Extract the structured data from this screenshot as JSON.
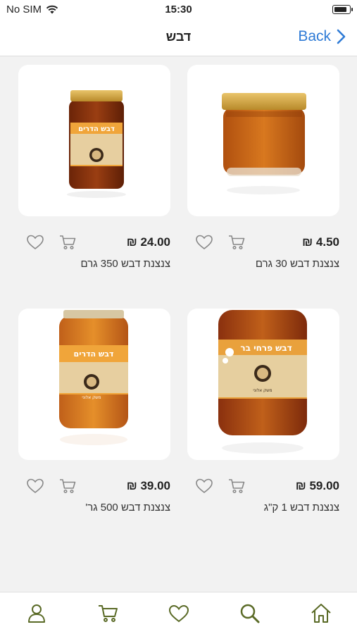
{
  "status": {
    "carrier": "No SIM",
    "time": "15:30"
  },
  "nav": {
    "title": "דבש",
    "back_label": "Back"
  },
  "products": [
    {
      "name": "צנצנת דבש 30 גרם",
      "price": "₪ 4.50"
    },
    {
      "name": "צנצנת דבש 350 גרם",
      "price": "₪ 24.00"
    },
    {
      "name": "צנצנת דבש 1 ק\"ג",
      "price": "₪ 59.00"
    },
    {
      "name": "צנצנת דבש 500 גר'",
      "price": "₪ 39.00"
    }
  ],
  "labels": {
    "jar_hadarim": "דבש הדרים",
    "jar_wildflowers": "דבש פרחי בר",
    "jar_brand": "משק אלוני"
  },
  "tabs": [
    "user-icon",
    "cart-icon",
    "heart-icon",
    "search-icon",
    "home-icon"
  ],
  "colors": {
    "accent": "#2f7bd6",
    "tab_icon": "#5a6a26",
    "honey": "#c0601a"
  }
}
